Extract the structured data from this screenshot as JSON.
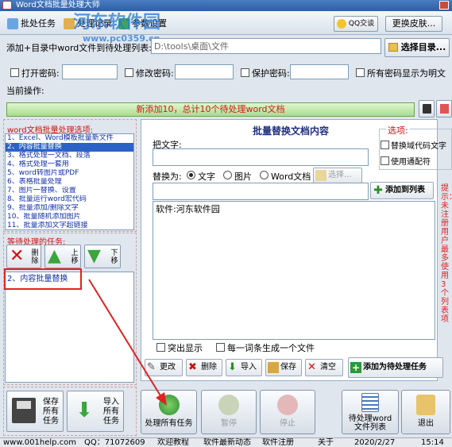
{
  "window": {
    "title": "Word文档批量处理大师"
  },
  "tabs": [
    {
      "label": "批处任务"
    },
    {
      "label": "处理记录"
    },
    {
      "label": "参数设置"
    }
  ],
  "top_buttons": {
    "qq": "QQ交谈",
    "skin": "更换皮肤..."
  },
  "watermark": {
    "line1": "河东软件园",
    "line2": "www.pc0359.cn"
  },
  "add_dir": {
    "label": "添加+目录中word文件到待处理列表:",
    "path_value": "D:\\tools\\桌面\\文件",
    "browse_button": "选择目录..."
  },
  "passwords": {
    "open_label": "打开密码:",
    "modify_label": "修改密码:",
    "protect_label": "保护密码:",
    "show_plain_label": "所有密码显示为明文"
  },
  "current_op": {
    "label": "当前操作:",
    "status": "新添加10，总计10个待处理word文档"
  },
  "options_list": {
    "heading": "word文档批量处理选项:",
    "items": [
      "1、Excel、Word模板批量新文件",
      "2、内容批量替换",
      "3、格式处理一文档、段落",
      "4、格式处理一套用",
      "5、word转图片或PDF",
      "6、表格批量处理",
      "7、图片一替换、设置",
      "8、批量运行word宏代码",
      "9、批量添加/删除文字",
      "10、批量随机添加图片",
      "11、批量添加文字超链接"
    ],
    "selected_index": 1
  },
  "pending": {
    "heading": "等待处理的任务:",
    "delete": "删除",
    "up": "上移",
    "down": "下移",
    "items": [
      "2、内容批量替换"
    ]
  },
  "left_bottom": {
    "save_all": "保存所有任务",
    "import_all": "导入所有任务"
  },
  "replace_panel": {
    "title": "批量替换文档内容",
    "find_label": "把文字:",
    "replace_as_label": "替换为:",
    "radio_text": "文字",
    "radio_image": "图片",
    "radio_word": "Word文档",
    "select_button": "选择...",
    "add_to_list": "添加到列表",
    "content_text": "软件:河东软件园",
    "chk_highlight": "突出显示",
    "chk_each_one": "每一词条生成一个文件",
    "btn_edit": "更改",
    "btn_delete": "删除",
    "btn_import": "导入",
    "btn_save": "保存",
    "btn_clear": "清空",
    "btn_add_task": "添加为待处理任务"
  },
  "options_box": {
    "heading": "选项:",
    "opt1": "替换域代码文字",
    "opt2": "使用通配符"
  },
  "side_hint": "提示：未注册用户最多使用3个列表项",
  "action_buttons": {
    "process_all": "处理所有任务",
    "pause": "暂停",
    "stop": "停止",
    "pending_list": "待处理word文件列表",
    "exit": "退出"
  },
  "status": {
    "site": "www.001help.com",
    "qq": "QQ：71072609",
    "welcome": "欢迎教程",
    "news": "软件最新动态",
    "register": "软件注册",
    "about": "关于",
    "date": "2020/2/27",
    "time": "15:14"
  },
  "colors": {
    "accent": "#2a62c8",
    "alert": "#d01010",
    "progress": "#a9dc8d"
  }
}
